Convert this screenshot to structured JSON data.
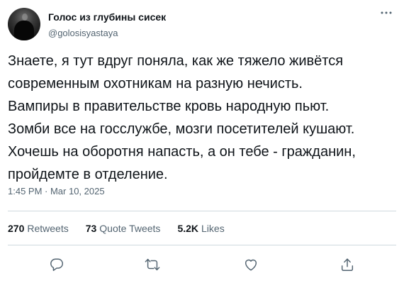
{
  "author": {
    "display_name": "Голос из глубины сисек",
    "handle": "@golosisyastaya",
    "avatar_icon": "user-avatar-photo"
  },
  "tweet": {
    "text": "Знаете, я тут вдруг поняла, как же тяжело живётся\nсовременным охотникам на разную нечисть.\nВампиры в правительстве кровь народную пьют.\nЗомби все на госслужбе, мозги посетителей кушают.\nХочешь на оборотня напасть, а он тебе - гражданин,\nпройдемте в отделение.",
    "timestamp": "1:45 PM · Mar 10, 2025"
  },
  "stats": [
    {
      "count": "270",
      "label": "Retweets"
    },
    {
      "count": "73",
      "label": "Quote Tweets"
    },
    {
      "count": "5.2K",
      "label": "Likes"
    }
  ],
  "actions": [
    {
      "name": "reply",
      "icon": "reply-icon"
    },
    {
      "name": "retweet",
      "icon": "retweet-icon"
    },
    {
      "name": "like",
      "icon": "heart-icon"
    },
    {
      "name": "share",
      "icon": "share-icon"
    }
  ],
  "colors": {
    "text_primary": "#0f1419",
    "text_secondary": "#536471",
    "divider": "#cfd9de",
    "icon": "#536471"
  }
}
